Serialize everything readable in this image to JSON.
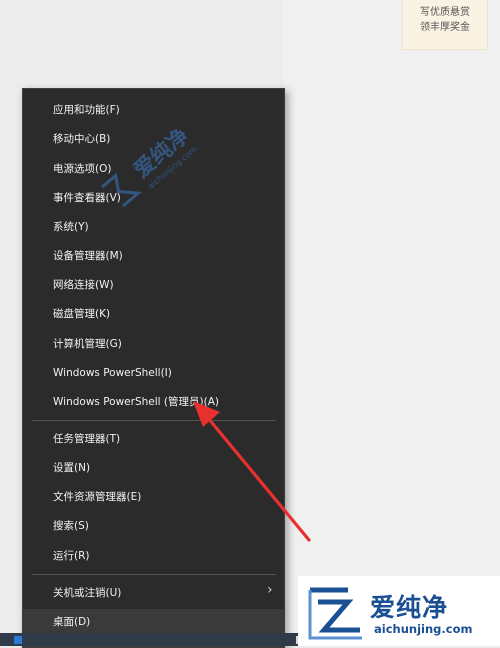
{
  "promo": {
    "line1": "写优质悬赏",
    "line2": "领丰厚奖金"
  },
  "menu": {
    "items": [
      {
        "label": "应用和功能(F)"
      },
      {
        "label": "移动中心(B)"
      },
      {
        "label": "电源选项(O)"
      },
      {
        "label": "事件查看器(V)"
      },
      {
        "label": "系统(Y)"
      },
      {
        "label": "设备管理器(M)"
      },
      {
        "label": "网络连接(W)"
      },
      {
        "label": "磁盘管理(K)"
      },
      {
        "label": "计算机管理(G)"
      },
      {
        "label": "Windows PowerShell(I)"
      },
      {
        "label": "Windows PowerShell (管理员)(A)"
      },
      {
        "label": "任务管理器(T)"
      },
      {
        "label": "设置(N)"
      },
      {
        "label": "文件资源管理器(E)"
      },
      {
        "label": "搜索(S)"
      },
      {
        "label": "运行(R)"
      },
      {
        "label": "关机或注销(U)"
      },
      {
        "label": "桌面(D)"
      }
    ],
    "submenu_icon": "chevron-right-icon"
  },
  "annotation": {
    "arrow_color": "#e8312e"
  },
  "watermark": {
    "text": "爱纯净",
    "sub": "aichunjing.com"
  },
  "logo": {
    "text": "爱纯净",
    "domain": "aichunjing.com",
    "color": "#1a4f93"
  }
}
